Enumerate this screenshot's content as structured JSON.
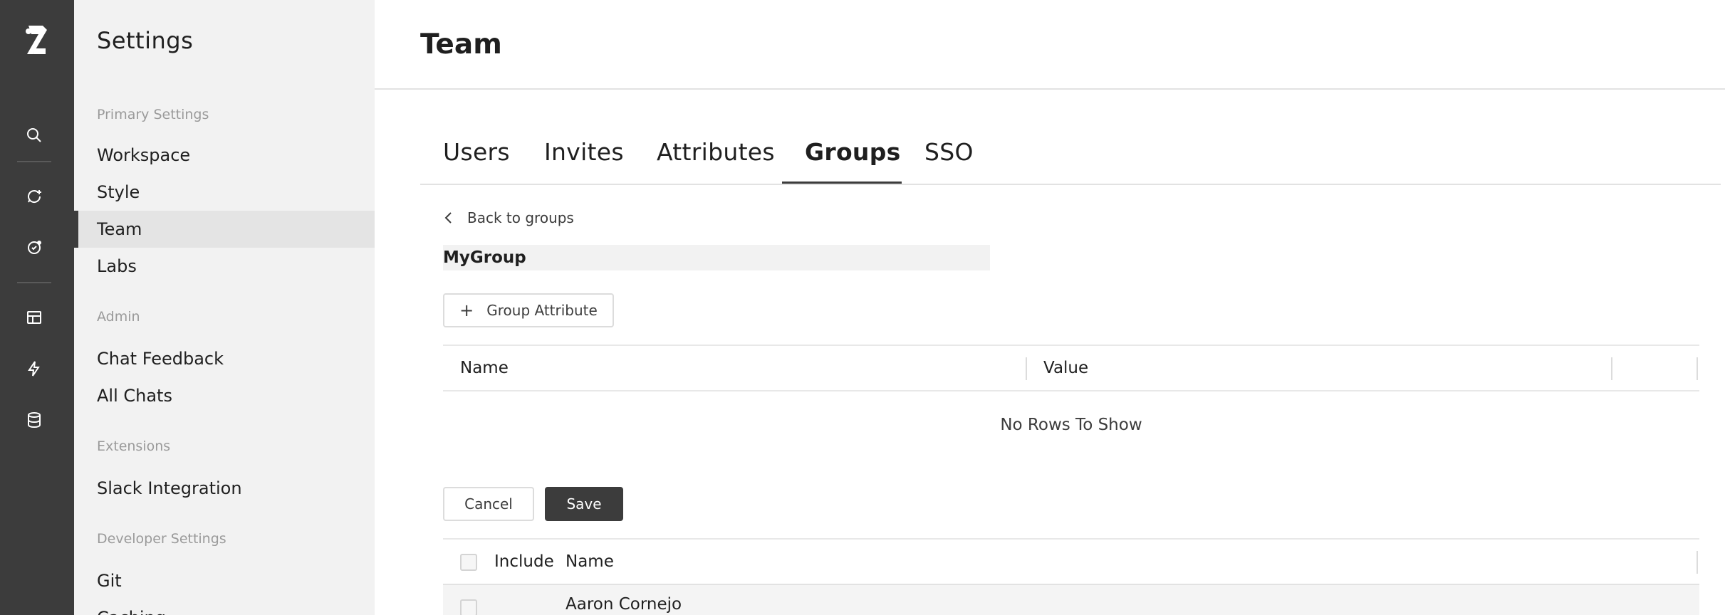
{
  "rail": {
    "icons": [
      "logo-icon",
      "search-icon",
      "new-chat-icon",
      "assistant-icon",
      "layout-icon",
      "lightning-icon",
      "database-icon"
    ]
  },
  "sidebar": {
    "title": "Settings",
    "sections": [
      {
        "label": "Primary Settings",
        "items": [
          "Workspace",
          "Style",
          "Team",
          "Labs"
        ]
      },
      {
        "label": "Admin",
        "items": [
          "Chat Feedback",
          "All Chats"
        ]
      },
      {
        "label": "Extensions",
        "items": [
          "Slack Integration"
        ]
      },
      {
        "label": "Developer Settings",
        "items": [
          "Git",
          "Caching"
        ]
      }
    ],
    "active_item": "Team"
  },
  "header": {
    "title": "Team"
  },
  "tabs": {
    "items": [
      "Users",
      "Invites",
      "Attributes",
      "Groups",
      "SSO"
    ],
    "active": "Groups"
  },
  "group": {
    "back_label": "Back to groups",
    "name": "MyGroup",
    "add_attribute_label": "Group Attribute",
    "attributes_table": {
      "columns": [
        "Name",
        "Value"
      ],
      "empty_message": "No Rows To Show"
    },
    "cancel_label": "Cancel",
    "save_label": "Save",
    "members_table": {
      "columns": [
        "Include",
        "Name"
      ],
      "rows": [
        {
          "name": "Aaron Cornejo",
          "include": false
        }
      ]
    }
  },
  "colors": {
    "rail": "#3c3c3c",
    "sidebar": "#f2f2f2",
    "accent": "#3c3c3c"
  }
}
